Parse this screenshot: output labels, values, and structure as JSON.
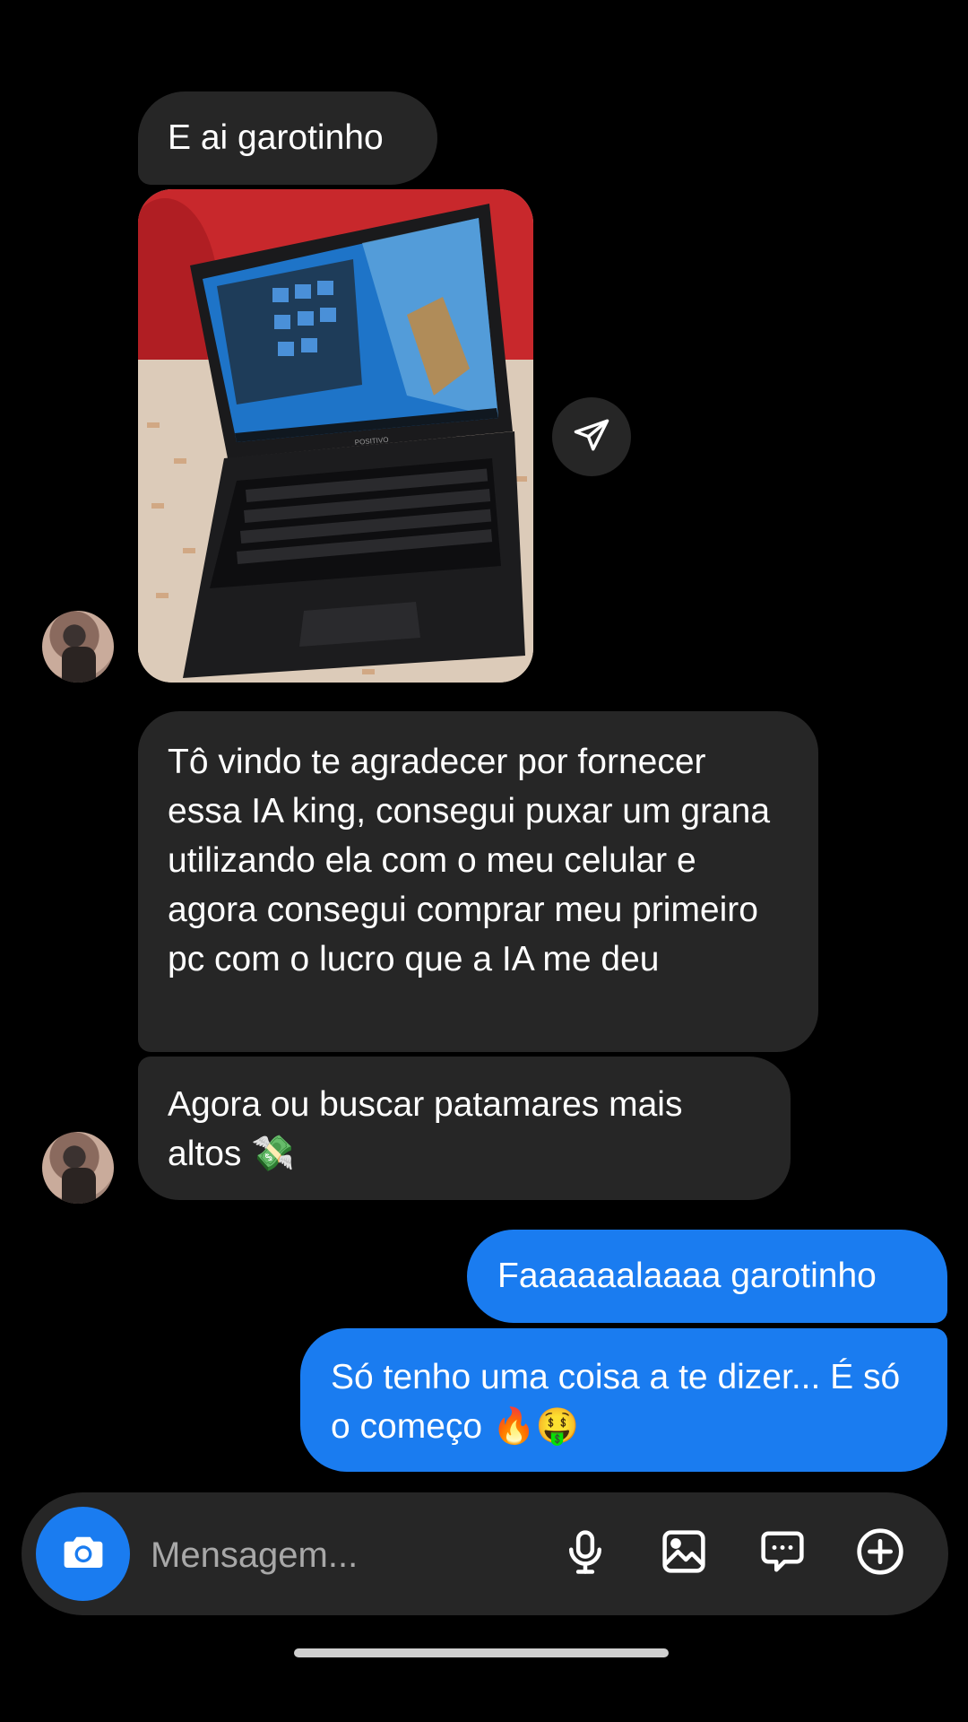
{
  "messages": {
    "m1": "E ai garotinho",
    "m2": "Tô vindo te agradecer por fornecer essa IA king, consegui puxar um grana utilizando ela com o meu celular e agora consegui comprar meu primeiro pc com o lucro que a IA me deu",
    "m3": "Agora ou buscar patamares mais altos",
    "m3_emoji": "💸",
    "m4": "Faaaaaalaaaa garotinho",
    "m5": "Só tenho uma coisa a te dizer... É só o começo",
    "m5_emoji": "🔥🤑"
  },
  "photo": {
    "laptop_brand": "POSITIVO"
  },
  "composer": {
    "placeholder": "Mensagem..."
  },
  "icons": {
    "share": "paper-plane-icon",
    "camera": "camera-icon",
    "mic": "microphone-icon",
    "gallery": "image-icon",
    "sticker": "chat-bubble-icon",
    "more": "plus-circle-icon"
  },
  "colors": {
    "background": "#000000",
    "incoming_bubble": "#262626",
    "outgoing_bubble": "#1a7cf0"
  }
}
